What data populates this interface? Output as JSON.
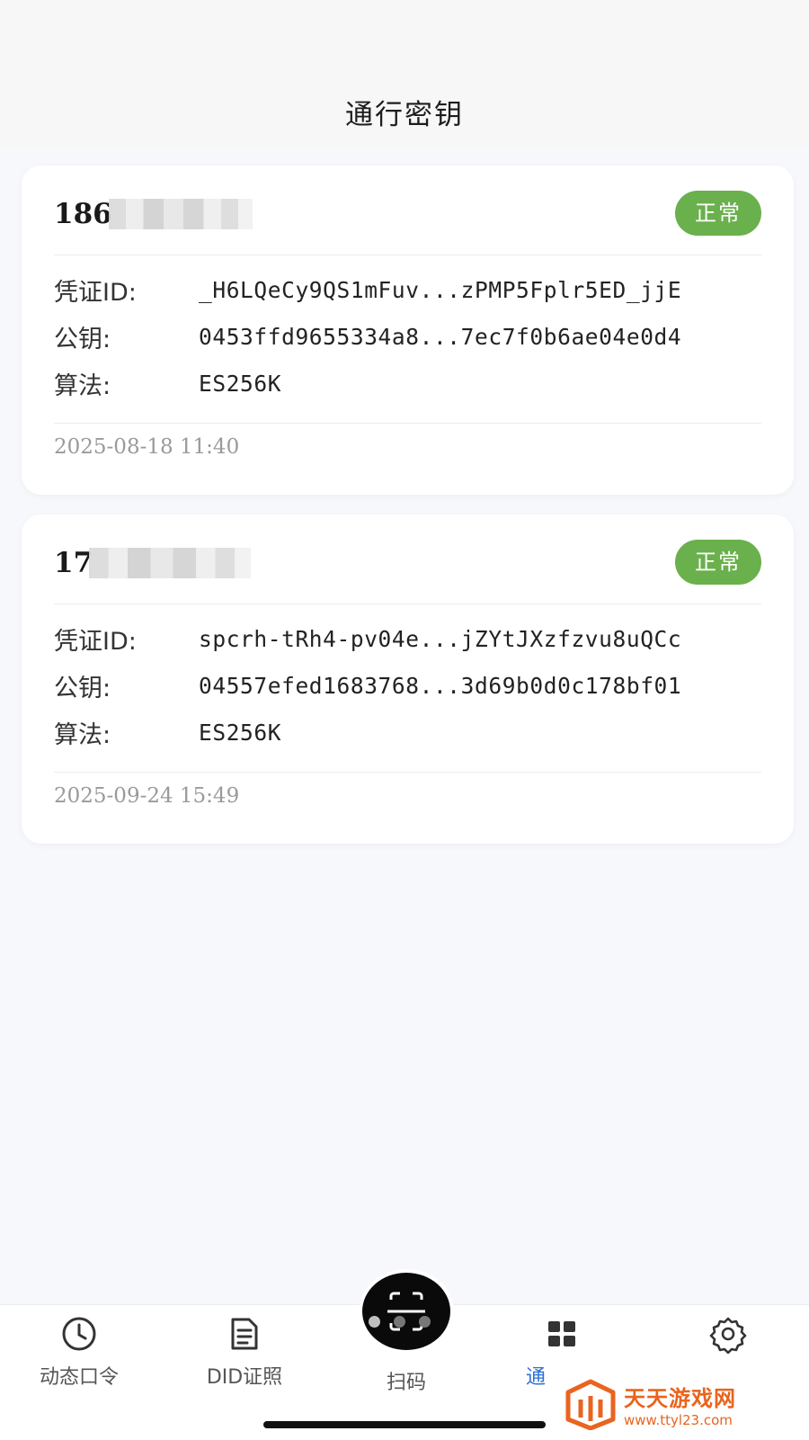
{
  "header": {
    "title": "通行密钥"
  },
  "labels": {
    "credential_id": "凭证ID:",
    "public_key": "公钥:",
    "algorithm": "算法:"
  },
  "cards": [
    {
      "phone_visible": "186",
      "status": "正常",
      "credential_id": "_H6LQeCy9QS1mFuv...zPMP5Fplr5ED_jjE",
      "public_key": "0453ffd9655334a8...7ec7f0b6ae04e0d4",
      "algorithm": "ES256K",
      "date": "2025-08-18 11:40"
    },
    {
      "phone_visible": "17",
      "status": "正常",
      "credential_id": "spcrh-tRh4-pv04e...jZYtJXzfzvu8uQCc",
      "public_key": "04557efed1683768...3d69b0d0c178bf01",
      "algorithm": "ES256K",
      "date": "2025-09-24 15:49"
    }
  ],
  "tabbar": {
    "items": [
      {
        "label": "动态口令",
        "icon": "clock-icon"
      },
      {
        "label": "DID证照",
        "icon": "document-icon"
      },
      {
        "label": "扫码",
        "icon": "scan-icon"
      },
      {
        "label": "通",
        "icon": "grid-icon",
        "active": true
      },
      {
        "label": "",
        "icon": "gear-icon"
      }
    ]
  },
  "watermark": {
    "title": "天天游戏网",
    "url": "www.ttyl23.com"
  },
  "colors": {
    "status_green": "#6ab04c",
    "active_blue": "#2b6fd6",
    "watermark_orange": "#e8641f"
  }
}
